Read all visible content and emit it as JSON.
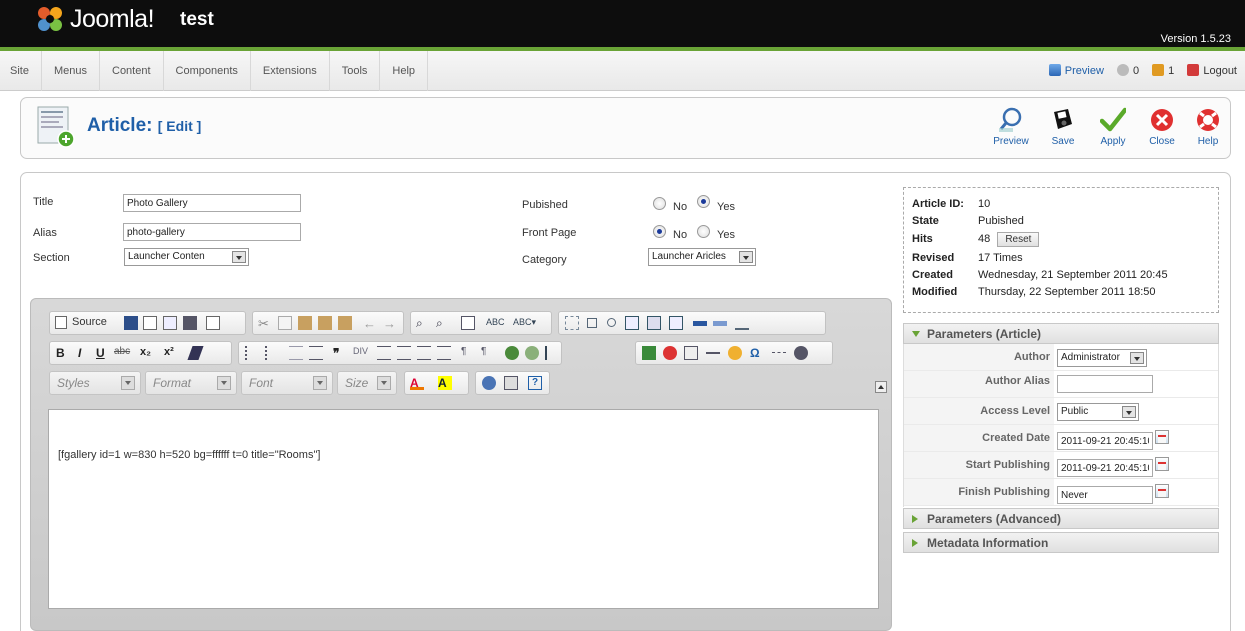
{
  "header": {
    "logo_text": "Joomla!",
    "site_name": "test",
    "version": "Version 1.5.23"
  },
  "menu": {
    "items": [
      "Site",
      "Menus",
      "Content",
      "Components",
      "Extensions",
      "Tools",
      "Help"
    ]
  },
  "status": {
    "preview": "Preview",
    "messages": "0",
    "users": "1",
    "logout": "Logout"
  },
  "toolbar": {
    "title": "Article:",
    "subtitle": "[ Edit ]",
    "buttons": {
      "preview": "Preview",
      "save": "Save",
      "apply": "Apply",
      "close": "Close",
      "help": "Help"
    }
  },
  "details": {
    "title_label": "Title",
    "title_value": "Photo Gallery",
    "alias_label": "Alias",
    "alias_value": "photo-gallery",
    "section_label": "Section",
    "section_value": "Launcher Conten",
    "published_label": "Pubished",
    "front_page_label": "Front Page",
    "category_label": "Category",
    "category_value": "Launcher Aricles",
    "no_label": "No",
    "yes_label": "Yes",
    "published": "Yes",
    "front_page": "No"
  },
  "editor": {
    "source_label": "Source",
    "styles_label": "Styles",
    "format_label": "Format",
    "font_label": "Font",
    "size_label": "Size",
    "content": "[fgallery id=1 w=830 h=520 bg=ffffff t=0 title=\"Rooms\"]",
    "toolbar_icons": [
      "source-icon",
      "save-icon",
      "new-page-icon",
      "preview-icon",
      "print-icon",
      "templates-icon",
      "cut-icon",
      "copy-icon",
      "paste-icon",
      "paste-text-icon",
      "paste-word-icon",
      "undo-icon",
      "redo-icon",
      "find-icon",
      "replace-icon",
      "select-all-icon",
      "spellcheck-icon",
      "scayt-icon",
      "form-icon",
      "checkbox-icon",
      "radio-icon",
      "textfield-icon",
      "textarea-icon",
      "select-icon",
      "button-icon",
      "image-button-icon",
      "hidden-field-icon",
      "bold-icon",
      "italic-icon",
      "underline-icon",
      "strike-icon",
      "subscript-icon",
      "superscript-icon",
      "remove-format-icon",
      "numbered-list-icon",
      "bulleted-list-icon",
      "outdent-icon",
      "indent-icon",
      "blockquote-icon",
      "div-icon",
      "align-left-icon",
      "align-center-icon",
      "align-right-icon",
      "justify-icon",
      "ltr-icon",
      "rtl-icon",
      "link-icon",
      "unlink-icon",
      "anchor-icon",
      "image-icon",
      "flash-icon",
      "table-icon",
      "hr-icon",
      "smiley-icon",
      "special-char-icon",
      "page-break-icon",
      "iframe-icon",
      "text-color-icon",
      "bg-color-icon",
      "maximize-icon",
      "show-blocks-icon",
      "about-icon"
    ]
  },
  "info": {
    "article_id_label": "Article ID:",
    "article_id": "10",
    "state_label": "State",
    "state": "Pubished",
    "hits_label": "Hits",
    "hits": "48",
    "reset_label": "Reset",
    "revised_label": "Revised",
    "revised": "17 Times",
    "created_label": "Created",
    "created": "Wednesday, 21 September 2011 20:45",
    "modified_label": "Modified",
    "modified": "Thursday, 22 September 2011 18:50"
  },
  "params": {
    "article_header": "Parameters (Article)",
    "advanced_header": "Parameters (Advanced)",
    "metadata_header": "Metadata Information",
    "author_label": "Author",
    "author_value": "Administrator",
    "author_alias_label": "Author Alias",
    "author_alias_value": "",
    "access_label": "Access Level",
    "access_value": "Public",
    "created_date_label": "Created Date",
    "created_date_value": "2011-09-21 20:45:10",
    "start_pub_label": "Start Publishing",
    "start_pub_value": "2011-09-21 20:45:10",
    "finish_pub_label": "Finish Publishing",
    "finish_pub_value": "Never"
  },
  "colors": {
    "header_bg": "#0d0d0d",
    "accent_green": "#69a336",
    "title_blue": "#1f5fa8"
  }
}
